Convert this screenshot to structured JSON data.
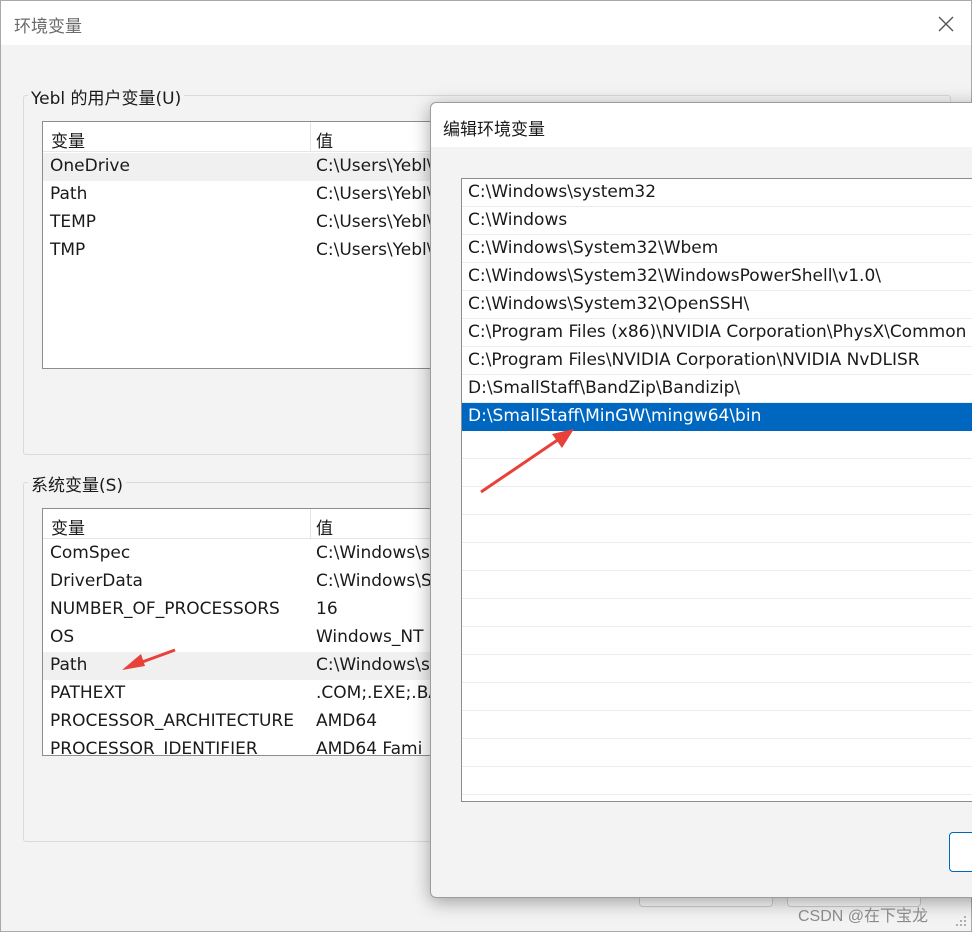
{
  "window": {
    "title": "环境变量"
  },
  "user_vars": {
    "group_label": "Yebl 的用户变量(U)",
    "columns": [
      "变量",
      "值"
    ],
    "rows": [
      {
        "name": "OneDrive",
        "value": "C:\\Users\\Yebl\\"
      },
      {
        "name": "Path",
        "value": "C:\\Users\\Yebl\\"
      },
      {
        "name": "TEMP",
        "value": "C:\\Users\\Yebl\\"
      },
      {
        "name": "TMP",
        "value": "C:\\Users\\Yebl\\"
      }
    ]
  },
  "system_vars": {
    "group_label": "系统变量(S)",
    "columns": [
      "变量",
      "值"
    ],
    "rows": [
      {
        "name": "ComSpec",
        "value": "C:\\Windows\\s"
      },
      {
        "name": "DriverData",
        "value": "C:\\Windows\\S"
      },
      {
        "name": "NUMBER_OF_PROCESSORS",
        "value": "16"
      },
      {
        "name": "OS",
        "value": "Windows_NT"
      },
      {
        "name": "Path",
        "value": "C:\\Windows\\s"
      },
      {
        "name": "PATHEXT",
        "value": ".COM;.EXE;.BA"
      },
      {
        "name": "PROCESSOR_ARCHITECTURE",
        "value": "AMD64"
      },
      {
        "name": "PROCESSOR_IDENTIFIER",
        "value": "AMD64 Fami"
      }
    ]
  },
  "edit_dialog": {
    "title": "编辑环境变量",
    "paths": [
      "C:\\Windows\\system32",
      "C:\\Windows",
      "C:\\Windows\\System32\\Wbem",
      "C:\\Windows\\System32\\WindowsPowerShell\\v1.0\\",
      "C:\\Windows\\System32\\OpenSSH\\",
      "C:\\Program Files (x86)\\NVIDIA Corporation\\PhysX\\Common",
      "C:\\Program Files\\NVIDIA Corporation\\NVIDIA NvDLISR",
      "D:\\SmallStaff\\BandZip\\Bandizip\\",
      "D:\\SmallStaff\\MinGW\\mingw64\\bin"
    ],
    "selected_index": 8
  },
  "watermark": "CSDN @在下宝龙",
  "colors": {
    "selection": "#0067c0",
    "annotation_arrow": "#e8413a"
  }
}
